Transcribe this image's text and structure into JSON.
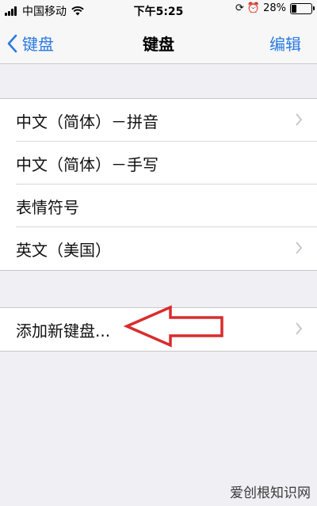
{
  "status_bar": {
    "carrier": "中国移动",
    "time": "下午5:25",
    "battery": "28%",
    "battery_level": 0.28
  },
  "nav": {
    "back_label": "键盘",
    "title": "键盘",
    "edit_label": "编辑"
  },
  "keyboards": [
    {
      "label": "中文（简体）－拼音",
      "chevron": true
    },
    {
      "label": "中文（简体）－手写",
      "chevron": false
    },
    {
      "label": "表情符号",
      "chevron": false
    },
    {
      "label": "英文（美国）",
      "chevron": true
    }
  ],
  "add_keyboard": {
    "label": "添加新键盘..."
  },
  "annotation": {
    "arrow_color": "#d92c2c"
  },
  "watermark": "爱创根知识网"
}
